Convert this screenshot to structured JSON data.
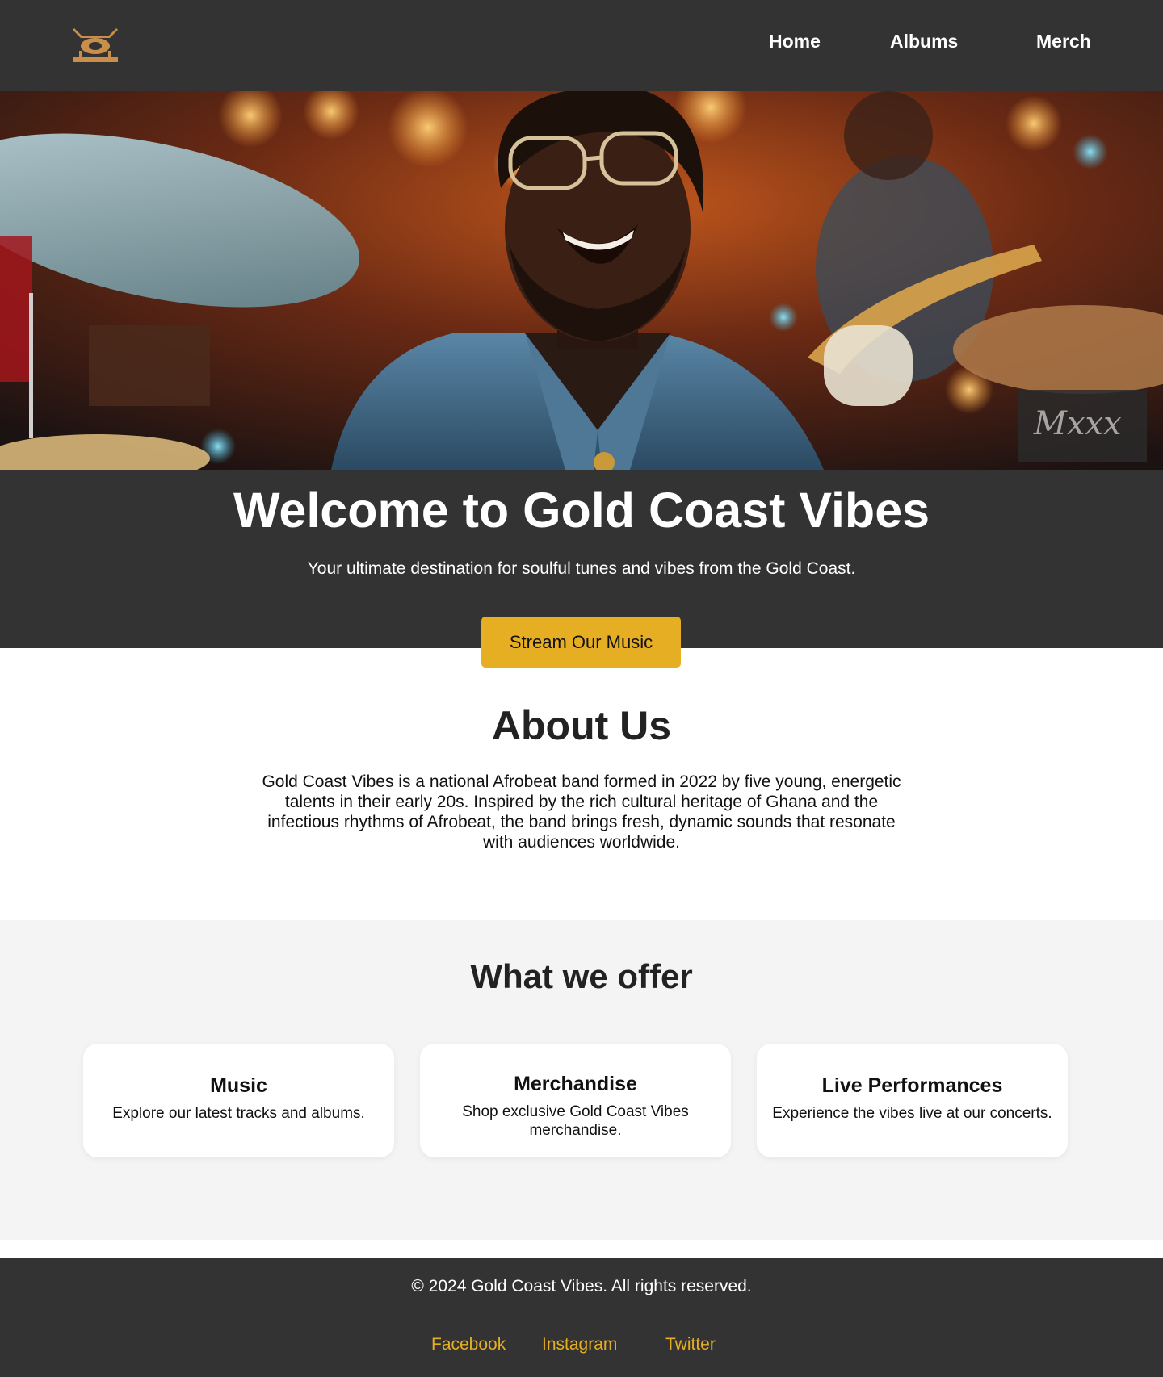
{
  "header": {
    "nav": {
      "home": "Home",
      "albums": "Albums",
      "merch": "Merch"
    }
  },
  "hero": {
    "title": "Welcome to Gold Coast Vibes",
    "subtitle": "Your ultimate destination for soulful tunes and vibes from the Gold Coast.",
    "cta_label": "Stream Our Music"
  },
  "about": {
    "title": "About Us",
    "text": "Gold Coast Vibes is a national Afrobeat band formed in 2022 by five young, energetic talents in their early 20s. Inspired by the rich cultural heritage of Ghana and the infectious rhythms of Afrobeat, the band brings fresh, dynamic sounds that resonate with audiences worldwide."
  },
  "offer": {
    "title": "What we offer",
    "cards": [
      {
        "title": "Music",
        "text": "Explore our latest tracks and albums."
      },
      {
        "title": "Merchandise",
        "text": "Shop exclusive Gold Coast Vibes merchandise."
      },
      {
        "title": "Live Performances",
        "text": "Experience the vibes live at our concerts."
      }
    ]
  },
  "footer": {
    "copyright": "© 2024 Gold Coast Vibes. All rights reserved.",
    "links": {
      "facebook": "Facebook",
      "instagram": "Instagram",
      "twitter": "Twitter"
    }
  },
  "colors": {
    "dark": "#333333",
    "accent": "#e6ae22",
    "offer_bg": "#f4f4f4"
  },
  "icons": {
    "logo": "drum-logo-icon"
  }
}
